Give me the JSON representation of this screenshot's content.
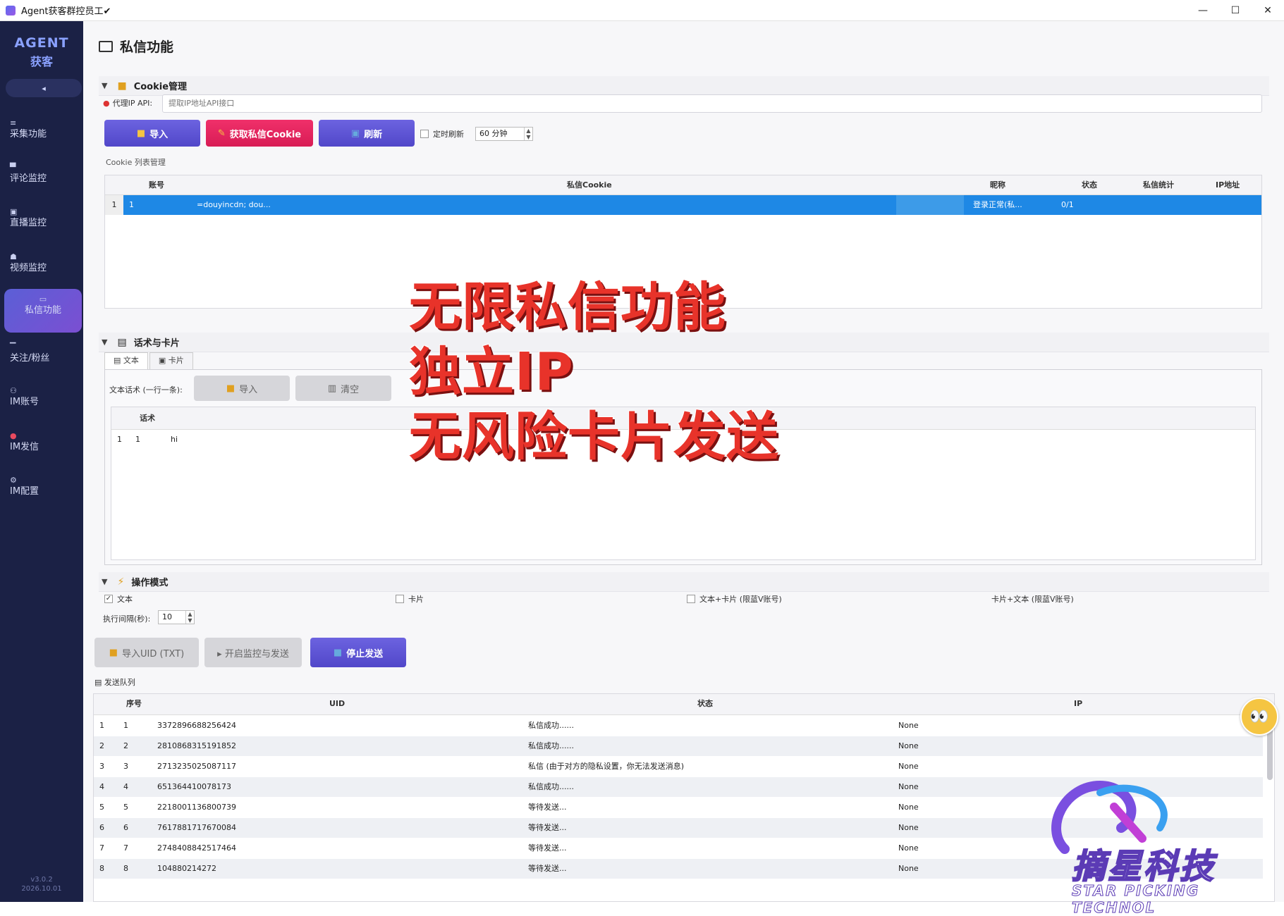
{
  "window": {
    "title": "Agent获客群控员工✔",
    "minimize": "—",
    "maximize": "☐",
    "close": "✕"
  },
  "sidebar": {
    "brand_line1": "AGENT",
    "brand_line2": "获客",
    "collapse_label": "◂",
    "items": [
      {
        "label": "采集功能",
        "icon": "≡"
      },
      {
        "label": "评论监控",
        "icon": "▀"
      },
      {
        "label": "直播监控",
        "icon": "▣"
      },
      {
        "label": "视频监控",
        "icon": "☗"
      },
      {
        "label": "私信功能",
        "icon": "▭"
      },
      {
        "label": "关注/粉丝",
        "icon": "▔"
      },
      {
        "label": "IM账号",
        "icon": "⚇"
      },
      {
        "label": "IM发信",
        "icon": "●"
      },
      {
        "label": "IM配置",
        "icon": "⚙"
      }
    ],
    "version_line1": "v3.0.2",
    "version_line2": "2026.10.01"
  },
  "page": {
    "title": "私信功能"
  },
  "cookie_section": {
    "title": "Cookie管理",
    "proxy_label": "代理IP API:",
    "proxy_placeholder": "提取IP地址API接口",
    "import_label": "导入",
    "fetch_cookie_label": "获取私信Cookie",
    "refresh_label": "刷新",
    "auto_refresh_label": "定时刷新",
    "interval_value": "60 分钟",
    "list_label": "Cookie 列表管理",
    "columns": [
      "账号",
      "私信Cookie",
      "昵称",
      "状态",
      "私信统计",
      "IP地址"
    ],
    "rows": [
      {
        "index": "1",
        "account": "1",
        "cookie": "=douyincdn; dou...",
        "nickname": "",
        "status": "登录正常(私...",
        "count": "0/1",
        "ip": ""
      }
    ]
  },
  "script_section": {
    "title": "话术与卡片",
    "tabs": [
      "文本",
      "卡片"
    ],
    "text_list_label": "文本话术 (一行一条):",
    "import_label": "导入",
    "clear_label": "清空",
    "columns": [
      "话术"
    ],
    "rows": [
      {
        "index": "1",
        "no": "1",
        "text": "hi"
      }
    ]
  },
  "overlay": {
    "line1": "无限私信功能",
    "line2": "独立IP",
    "line3": "无风险卡片发送"
  },
  "operation_section": {
    "title": "操作模式",
    "modes": [
      {
        "label": "文本",
        "checked": "✓"
      },
      {
        "label": "卡片",
        "checked": ""
      },
      {
        "label": "文本+卡片 (限蓝V账号)",
        "checked": ""
      },
      {
        "label": "卡片+文本 (限蓝V账号)",
        "checked": ""
      }
    ],
    "interval_label": "执行间隔(秒):",
    "interval_value": "10",
    "import_uid_label": "导入UID (TXT)",
    "start_label": "▸ 开启监控与发送",
    "stop_label": "停止发送",
    "queue_label": "发送队列"
  },
  "queue_table": {
    "columns": [
      "序号",
      "UID",
      "状态",
      "IP"
    ],
    "rows": [
      {
        "index": "1",
        "no": "1",
        "uid": "3372896688256424",
        "status": "私信成功......",
        "ip": "None"
      },
      {
        "index": "2",
        "no": "2",
        "uid": "2810868315191852",
        "status": "私信成功......",
        "ip": "None"
      },
      {
        "index": "3",
        "no": "3",
        "uid": "2713235025087117",
        "status": "私信 (由于对方的隐私设置，你无法发送消息)",
        "ip": "None"
      },
      {
        "index": "4",
        "no": "4",
        "uid": "651364410078173",
        "status": "私信成功......",
        "ip": "None"
      },
      {
        "index": "5",
        "no": "5",
        "uid": "2218001136800739",
        "status": "等待发送...",
        "ip": "None"
      },
      {
        "index": "6",
        "no": "6",
        "uid": "7617881717670084",
        "status": "等待发送...",
        "ip": "None"
      },
      {
        "index": "7",
        "no": "7",
        "uid": "2748408842517464",
        "status": "等待发送...",
        "ip": "None"
      },
      {
        "index": "8",
        "no": "8",
        "uid": "104880214272",
        "status": "等待发送...",
        "ip": "None"
      }
    ]
  },
  "watermark_logo": {
    "name": "摘星科技",
    "sub": "STAR PICKING TECHNOL"
  },
  "colors": {
    "sidebar": "#1b2145",
    "accent": "#5b5fd6",
    "pink": "#e8245f",
    "selected_row": "#1e88e5",
    "overlay_text": "#e8332a"
  }
}
